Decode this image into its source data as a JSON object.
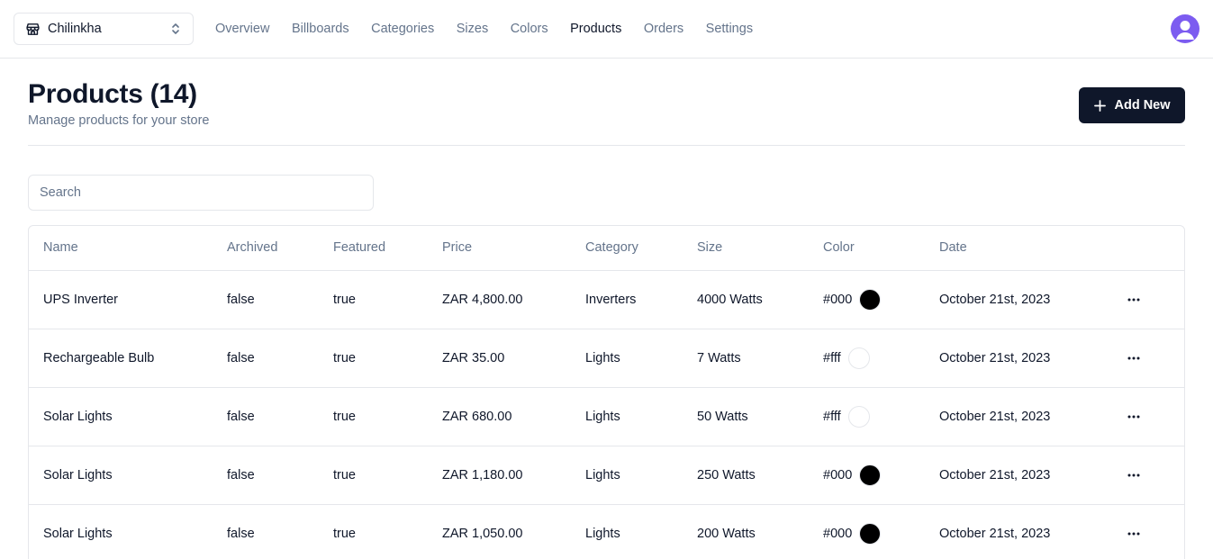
{
  "store": {
    "name": "Chilinkha"
  },
  "nav": {
    "items": [
      {
        "label": "Overview",
        "active": false
      },
      {
        "label": "Billboards",
        "active": false
      },
      {
        "label": "Categories",
        "active": false
      },
      {
        "label": "Sizes",
        "active": false
      },
      {
        "label": "Colors",
        "active": false
      },
      {
        "label": "Products",
        "active": true
      },
      {
        "label": "Orders",
        "active": false
      },
      {
        "label": "Settings",
        "active": false
      }
    ]
  },
  "header": {
    "title": "Products (14)",
    "subtitle": "Manage products for your store",
    "add_label": "Add New"
  },
  "search": {
    "placeholder": "Search"
  },
  "table": {
    "columns": [
      "Name",
      "Archived",
      "Featured",
      "Price",
      "Category",
      "Size",
      "Color",
      "Date"
    ],
    "rows": [
      {
        "name": "UPS Inverter",
        "archived": "false",
        "featured": "true",
        "price": "ZAR 4,800.00",
        "category": "Inverters",
        "size": "4000 Watts",
        "color": "#000",
        "date": "October 21st, 2023"
      },
      {
        "name": "Rechargeable Bulb",
        "archived": "false",
        "featured": "true",
        "price": "ZAR 35.00",
        "category": "Lights",
        "size": "7 Watts",
        "color": "#fff",
        "date": "October 21st, 2023"
      },
      {
        "name": "Solar Lights",
        "archived": "false",
        "featured": "true",
        "price": "ZAR 680.00",
        "category": "Lights",
        "size": "50 Watts",
        "color": "#fff",
        "date": "October 21st, 2023"
      },
      {
        "name": "Solar Lights",
        "archived": "false",
        "featured": "true",
        "price": "ZAR 1,180.00",
        "category": "Lights",
        "size": "250 Watts",
        "color": "#000",
        "date": "October 21st, 2023"
      },
      {
        "name": "Solar Lights",
        "archived": "false",
        "featured": "true",
        "price": "ZAR 1,050.00",
        "category": "Lights",
        "size": "200 Watts",
        "color": "#000",
        "date": "October 21st, 2023"
      }
    ]
  },
  "icons": {
    "store": "store-icon",
    "switcher": "chevrons-up-down-icon",
    "avatar": "user-avatar-icon",
    "add": "plus-icon",
    "row_actions": "more-horizontal-icon"
  },
  "colors": {
    "primary": "#0f172a",
    "muted": "#64748b",
    "border": "#e5e7eb",
    "avatar": "#7c5cf0"
  }
}
